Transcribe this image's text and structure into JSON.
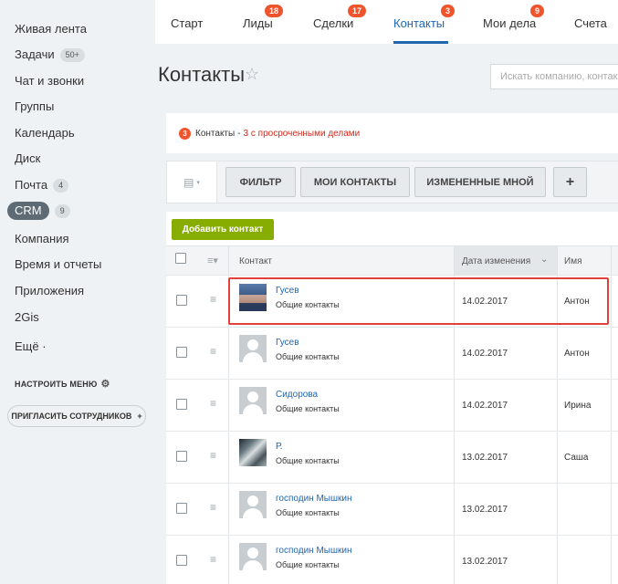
{
  "sidebar": {
    "items": [
      {
        "label": "Живая лента"
      },
      {
        "label": "Задачи",
        "badge": "50+"
      },
      {
        "label": "Чат и звонки"
      },
      {
        "label": "Группы"
      },
      {
        "label": "Календарь"
      },
      {
        "label": "Диск"
      },
      {
        "label": "Почта",
        "badge": "4"
      },
      {
        "label": "CRM",
        "badge": "9",
        "active": true
      },
      {
        "label": "Компания"
      },
      {
        "label": "Время и отчеты"
      },
      {
        "label": "Приложения"
      },
      {
        "label": "2Gis"
      },
      {
        "label": "Ещё ·"
      }
    ],
    "settings_label": "НАСТРОИТЬ МЕНЮ",
    "invite_label": "ПРИГЛАСИТЬ СОТРУДНИКОВ"
  },
  "tabs": [
    {
      "label": "Старт"
    },
    {
      "label": "Лиды",
      "badge": "18"
    },
    {
      "label": "Сделки",
      "badge": "17"
    },
    {
      "label": "Контакты",
      "badge": "3",
      "active": true
    },
    {
      "label": "Мои дела",
      "badge": "9"
    },
    {
      "label": "Счета"
    }
  ],
  "page": {
    "title": "Контакты",
    "search_placeholder": "Искать компанию, контакт"
  },
  "counter": {
    "count": "3",
    "label": "Контакты",
    "separator": "-",
    "overdue": "3 с просроченными делами"
  },
  "filters": {
    "filter_label": "ФИЛЬТР",
    "mine_label": "МОИ КОНТАКТЫ",
    "changed_label": "ИЗМЕНЕННЫЕ МНОЙ",
    "add_label": "+"
  },
  "grid": {
    "add_contact_label": "Добавить контакт",
    "columns": {
      "contact": "Контакт",
      "date": "Дата изменения",
      "name": "Имя"
    },
    "rows": [
      {
        "name": "Гусев",
        "type": "Общие контакты",
        "date": "14.02.2017",
        "first": "Антон",
        "avatar": "photo1"
      },
      {
        "name": "Гусев",
        "type": "Общие контакты",
        "date": "14.02.2017",
        "first": "Антон",
        "avatar": "placeholder"
      },
      {
        "name": "Сидорова",
        "type": "Общие контакты",
        "date": "14.02.2017",
        "first": "Ирина",
        "avatar": "placeholder"
      },
      {
        "name": "Р.",
        "type": "Общие контакты",
        "date": "13.02.2017",
        "first": "Саша",
        "avatar": "photo2"
      },
      {
        "name": "господин Мышкин",
        "type": "Общие контакты",
        "date": "13.02.2017",
        "first": "",
        "avatar": "placeholder"
      },
      {
        "name": "господин Мышкин",
        "type": "Общие контакты",
        "date": "13.02.2017",
        "first": "",
        "avatar": "placeholder"
      }
    ]
  },
  "colors": {
    "accent": "#2067b0",
    "badge": "#f0542d",
    "add_button": "#86ad00",
    "highlight": "#e0413a"
  }
}
